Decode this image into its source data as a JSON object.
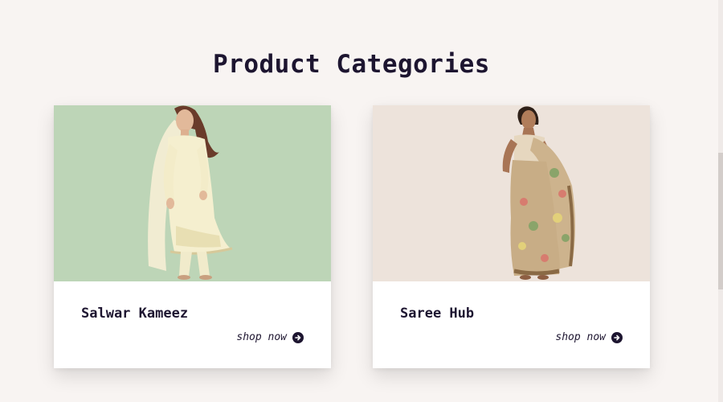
{
  "page": {
    "title": "Product Categories"
  },
  "colors": {
    "text": "#1d1530",
    "background": "#f8f4f2",
    "card1_bg": "#bdd5b7",
    "card2_bg": "#ede3db"
  },
  "categories": [
    {
      "title": "Salwar Kameez",
      "link_label": "shop now",
      "link_icon": "arrow-circle-right-icon",
      "image": "woman-in-salwar-kameez"
    },
    {
      "title": "Saree Hub",
      "link_label": "shop now",
      "link_icon": "arrow-circle-right-icon",
      "image": "woman-in-saree"
    }
  ]
}
